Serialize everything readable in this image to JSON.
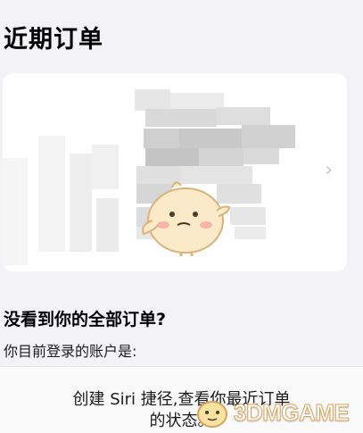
{
  "section": {
    "title": "近期订单"
  },
  "order_card": {
    "chevron": "›",
    "content_state": "pixelated"
  },
  "missing_orders": {
    "title": "没看到你的全部订单?",
    "account_label": "你目前登录的账户是:"
  },
  "siri": {
    "line1": "创建 Siri 捷径,查看你最近订单",
    "line2": "的状态。"
  },
  "watermark": {
    "text": "3DMGAME"
  },
  "colors": {
    "background": "#f2f2f7",
    "card": "#ffffff",
    "link": "#2b6fe0",
    "chevron": "#c7c7cc"
  },
  "icons": {
    "chevron": "chevron-right-icon",
    "watermark_mascot": "mascot-logo-icon"
  }
}
